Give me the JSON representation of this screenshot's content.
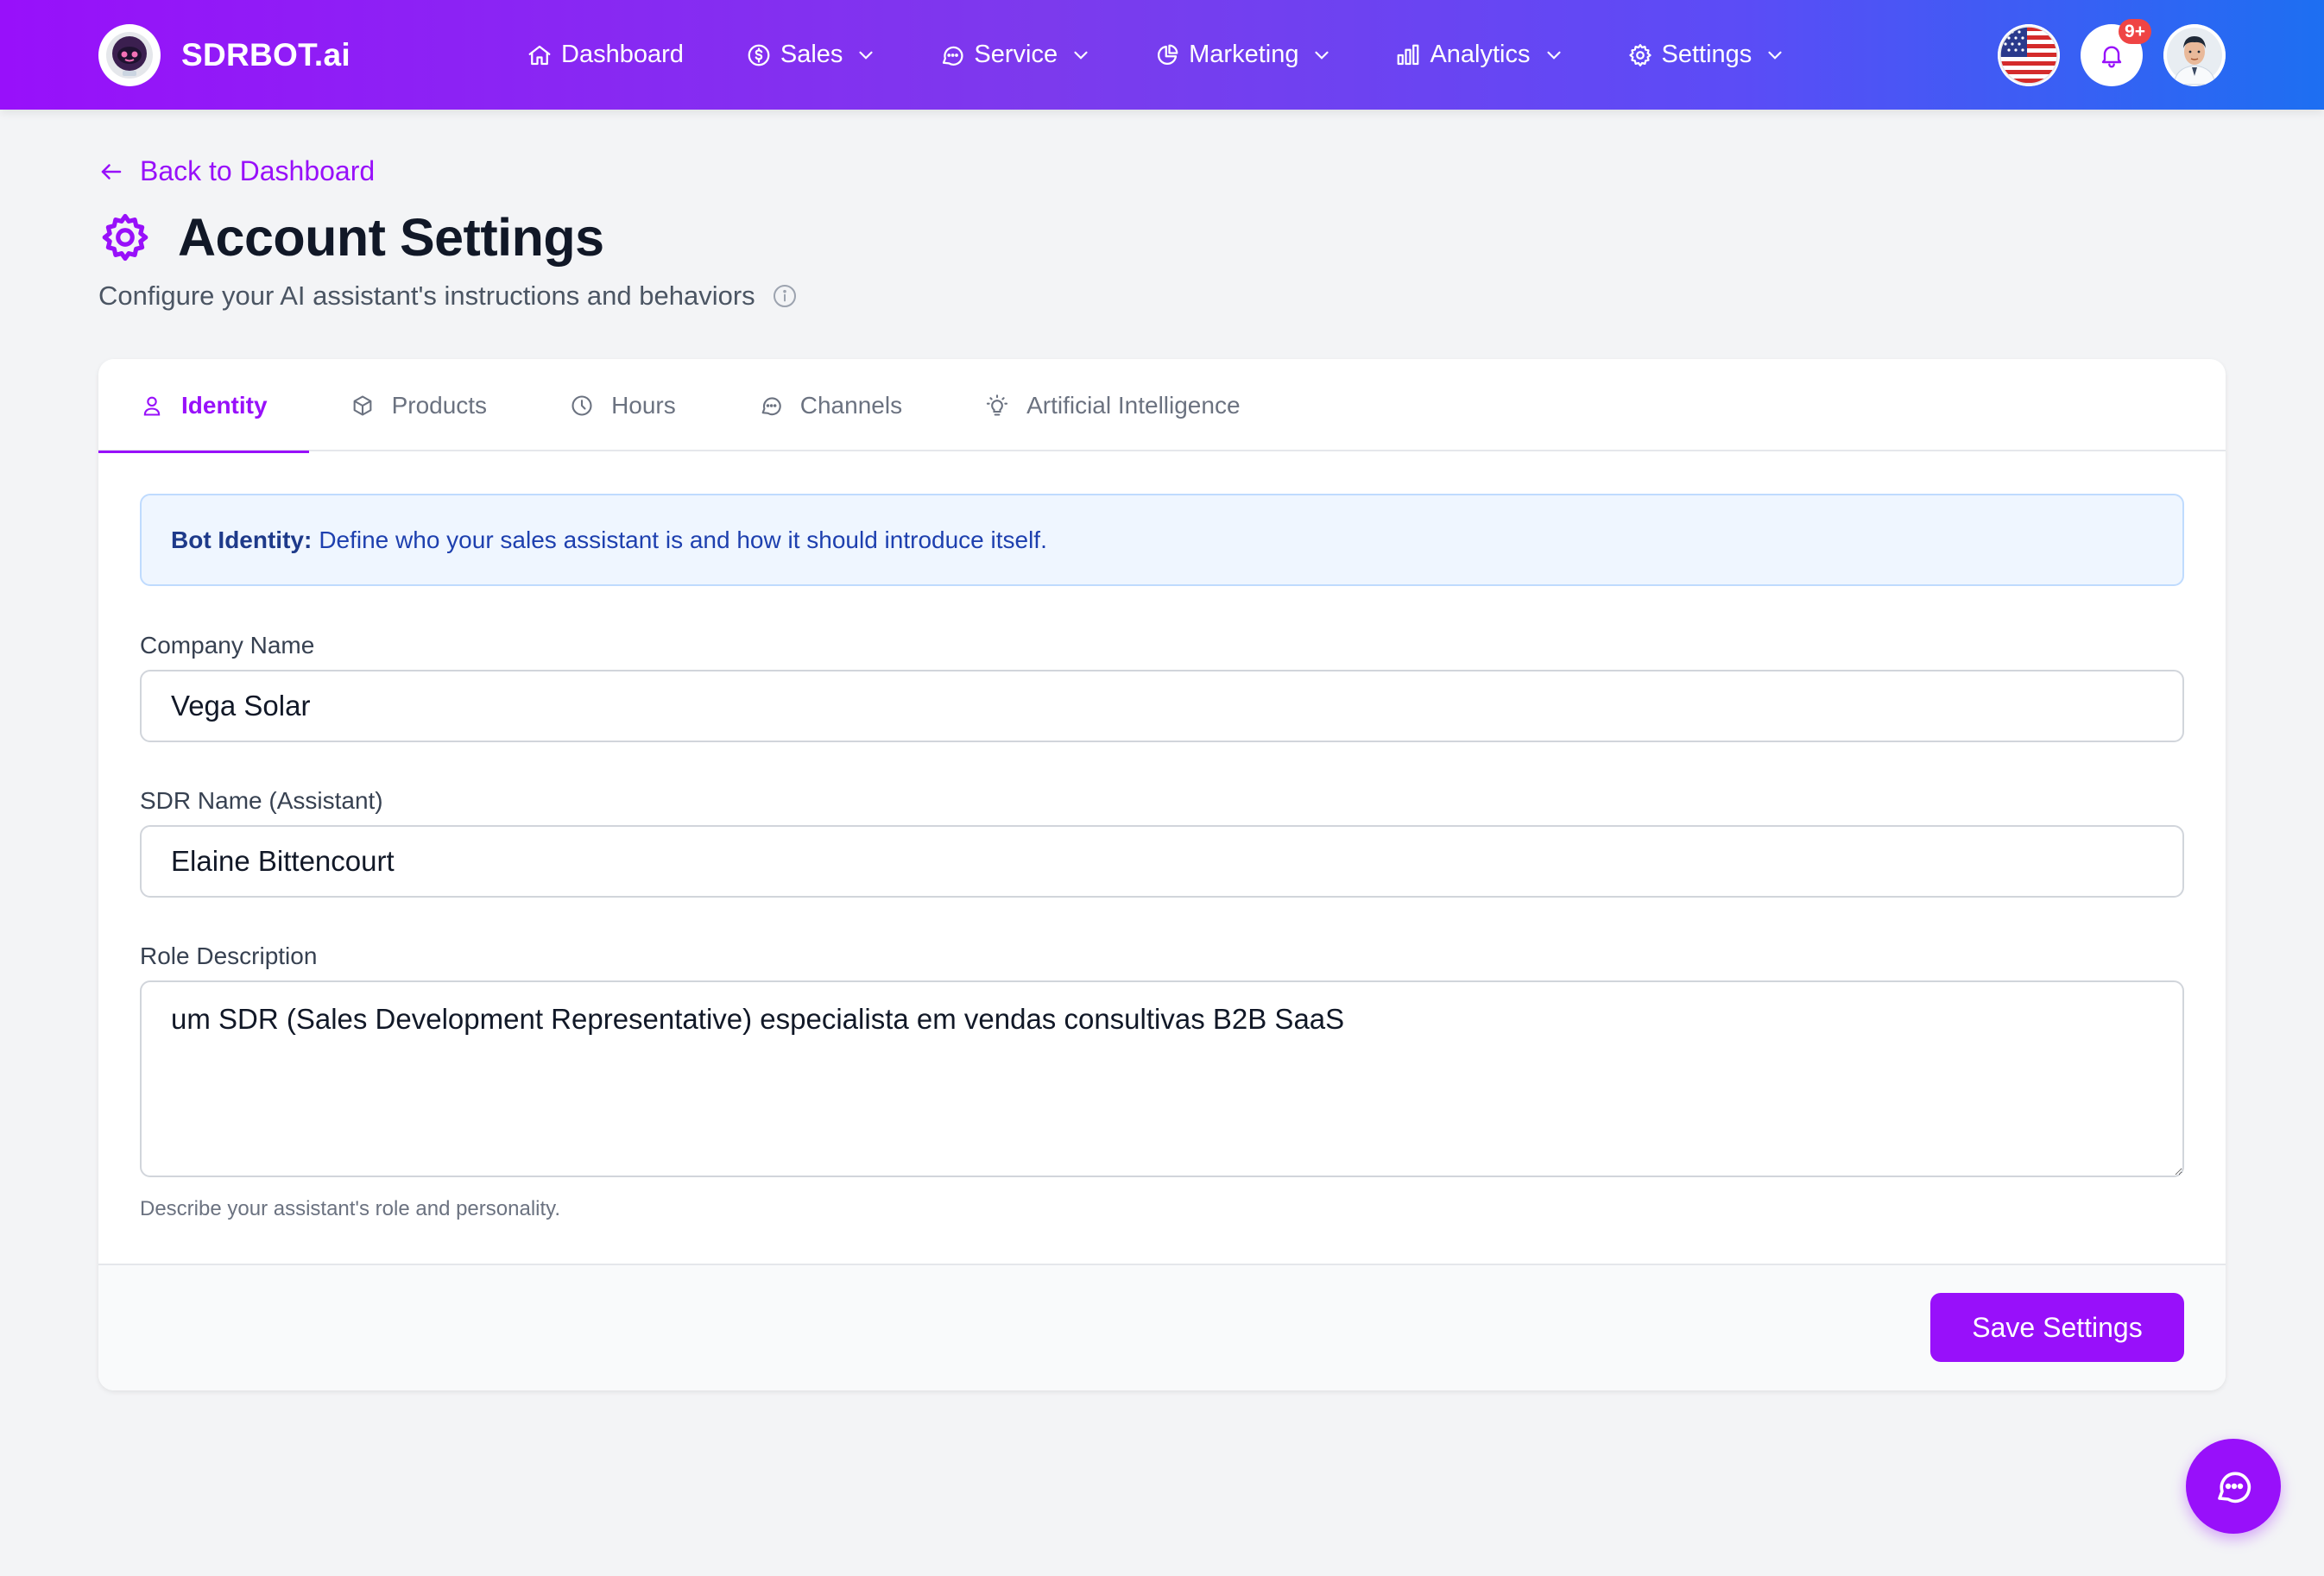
{
  "brand": {
    "name": "SDRBOT.ai",
    "logo_icon": "robot-icon"
  },
  "nav": {
    "items": [
      {
        "label": "Dashboard",
        "icon": "home-icon",
        "has_dropdown": false
      },
      {
        "label": "Sales",
        "icon": "dollar-icon",
        "has_dropdown": true
      },
      {
        "label": "Service",
        "icon": "chat-bubble-icon",
        "has_dropdown": true
      },
      {
        "label": "Marketing",
        "icon": "pie-chart-icon",
        "has_dropdown": true
      },
      {
        "label": "Analytics",
        "icon": "bar-chart-icon",
        "has_dropdown": true
      },
      {
        "label": "Settings",
        "icon": "gear-icon",
        "has_dropdown": true
      }
    ]
  },
  "header_right": {
    "language_flag": "us-flag-icon",
    "notifications_badge": "9+",
    "avatar": "user-avatar"
  },
  "page": {
    "back_link": "Back to Dashboard",
    "title": "Account Settings",
    "subtitle": "Configure your AI assistant's instructions and behaviors"
  },
  "tabs": [
    {
      "label": "Identity",
      "icon": "user-icon",
      "active": true
    },
    {
      "label": "Products",
      "icon": "cube-icon",
      "active": false
    },
    {
      "label": "Hours",
      "icon": "clock-icon",
      "active": false
    },
    {
      "label": "Channels",
      "icon": "chat-bubble-icon",
      "active": false
    },
    {
      "label": "Artificial Intelligence",
      "icon": "lightbulb-icon",
      "active": false
    }
  ],
  "notice": {
    "heading": "Bot Identity:",
    "text": "Define who your sales assistant is and how it should introduce itself."
  },
  "form": {
    "company_name": {
      "label": "Company Name",
      "value": "Vega Solar"
    },
    "sdr_name": {
      "label": "SDR Name (Assistant)",
      "value": "Elaine Bittencourt"
    },
    "role_description": {
      "label": "Role Description",
      "value": "um SDR (Sales Development Representative) especialista em vendas consultivas B2B SaaS",
      "help": "Describe your assistant's role and personality."
    }
  },
  "actions": {
    "save_label": "Save Settings"
  },
  "colors": {
    "accent": "#9810fa",
    "header_start": "#9810fa",
    "header_end": "#1d6ff2",
    "notice_bg": "#eff6ff",
    "badge": "#ef4444"
  }
}
